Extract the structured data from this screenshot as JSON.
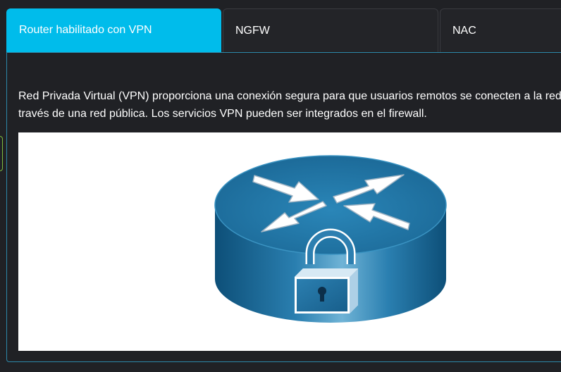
{
  "tabs": [
    {
      "label": "Router habilitado con VPN",
      "active": true
    },
    {
      "label": "NGFW",
      "active": false
    },
    {
      "label": "NAC",
      "active": false
    }
  ],
  "content": {
    "line1": "Red Privada Virtual (VPN) proporciona una conexión segura para que usuarios remotos se conecten a la red",
    "line2": "través de una red pública. Los servicios VPN pueden ser integrados en el firewall."
  },
  "figure": {
    "icon": "vpn-router-lock-icon"
  },
  "colors": {
    "accent": "#00bceb",
    "background": "#202125",
    "router": "#1f6a95"
  }
}
